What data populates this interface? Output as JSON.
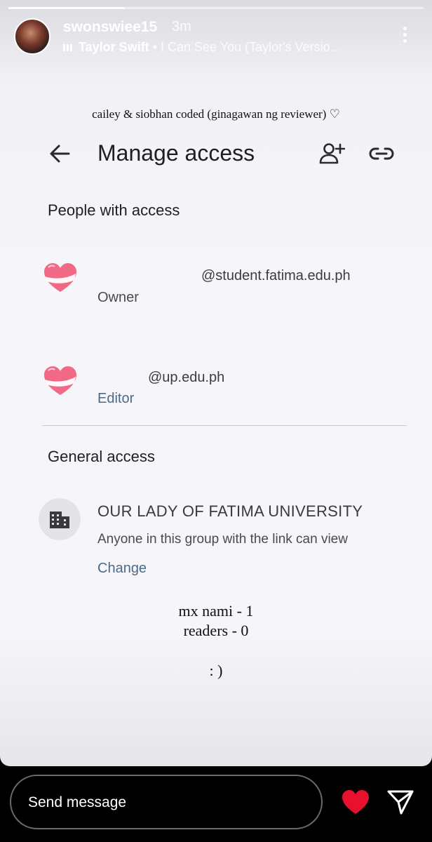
{
  "story": {
    "progress_fraction": 0.28,
    "username": "swonswiee15",
    "time": "3m",
    "music": {
      "artist": "Taylor Swift",
      "separator": " • ",
      "song": "I Can See You (Taylor's Versio..."
    },
    "caption": "cailey & siobhan coded (ginagawan ng reviewer) ♡"
  },
  "screenshot": {
    "title": "Manage access",
    "people_section_title": "People with access",
    "people": [
      {
        "email": "@student.fatima.edu.ph",
        "role": "Owner"
      },
      {
        "email": "@up.edu.ph",
        "role": "Editor"
      }
    ],
    "general_section_title": "General access",
    "general_access": {
      "group_name": "OUR LADY OF FATIMA UNIVERSITY",
      "description": "Anyone in this group with the link can view",
      "change_label": "Change"
    }
  },
  "notes": {
    "line1": "mx nami - 1",
    "line2": "readers - 0",
    "line3": ": )"
  },
  "reply_bar": {
    "placeholder": "Send message"
  },
  "colors": {
    "like": "#e8112d",
    "editor_role": "#4a6a86",
    "owner_role": "#4a4a4e"
  }
}
